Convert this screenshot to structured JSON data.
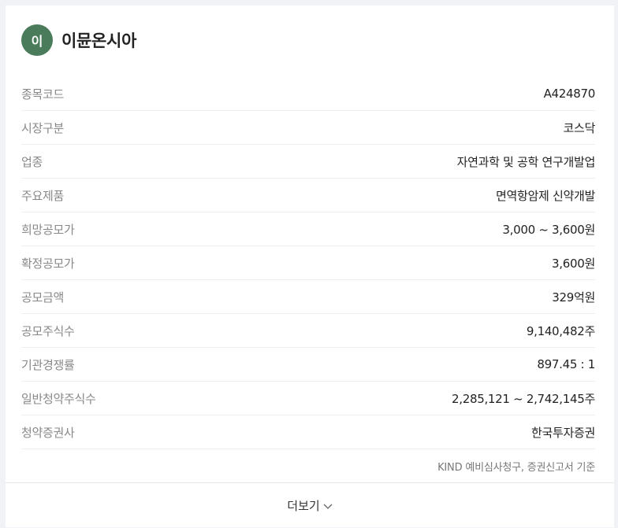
{
  "company": {
    "initial": "이",
    "name": "이뮨온시아"
  },
  "rows": [
    {
      "label": "종목코드",
      "value": "A424870"
    },
    {
      "label": "시장구분",
      "value": "코스닥"
    },
    {
      "label": "업종",
      "value": "자연과학 및 공학 연구개발업"
    },
    {
      "label": "주요제품",
      "value": "면역항암제 신약개발"
    },
    {
      "label": "희망공모가",
      "value": "3,000 ~ 3,600원"
    },
    {
      "label": "확정공모가",
      "value": "3,600원"
    },
    {
      "label": "공모금액",
      "value": "329억원"
    },
    {
      "label": "공모주식수",
      "value": "9,140,482주"
    },
    {
      "label": "기관경쟁률",
      "value": "897.45 : 1"
    },
    {
      "label": "일반청약주식수",
      "value": "2,285,121 ~ 2,742,145주"
    },
    {
      "label": "청약증권사",
      "value": "한국투자증권"
    }
  ],
  "note": "KIND 예비심사청구, 증권신고서 기준",
  "footer": {
    "more_label": "더보기",
    "more_icon": "chevron-down-icon"
  },
  "colors": {
    "avatar": "#4a7b5b"
  }
}
